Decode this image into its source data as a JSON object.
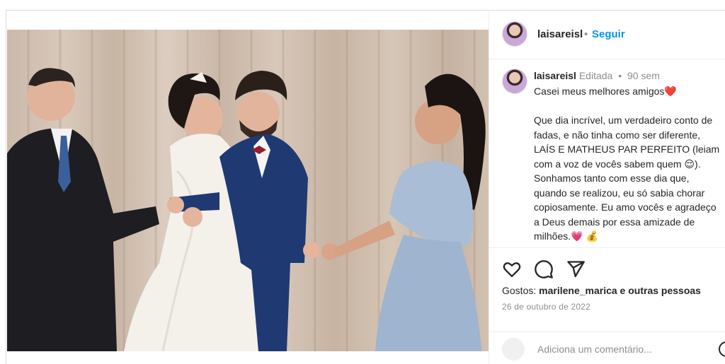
{
  "post": {
    "username": "laisareisl",
    "follow_label": "Seguir",
    "separator": "•"
  },
  "caption": {
    "username": "laisareisl",
    "edited_label": "Editada",
    "separator": "•",
    "age": "90 sem",
    "text": "Casei meus melhores amigos❤️\n\nQue dia incrível, um verdadeiro conto de fadas, e não tinha como ser diferente, LAÍS E MATHEUS PAR PERFEITO (leiam com a voz de vocês sabem quem 😌). Sonhamos tanto com esse dia que, quando se realizou, eu só sabia chorar copiosamente. Eu amo vocês e agradeço a Deus demais por essa amizade de milhões.💗 💰"
  },
  "engagement": {
    "likes_prefix": "Gostos: ",
    "likes_user": "marilene_marica",
    "likes_suffix": " e outras pessoas",
    "date": "26 de outubro de 2022"
  },
  "comment": {
    "placeholder": "Adiciona um comentário..."
  },
  "icons": {
    "like": "heart-icon",
    "comment": "comment-icon",
    "share": "share-icon",
    "user_tag": "user-tag-icon"
  },
  "colors": {
    "link": "#0095f6",
    "text": "#262626",
    "muted": "#8e8e8e"
  }
}
